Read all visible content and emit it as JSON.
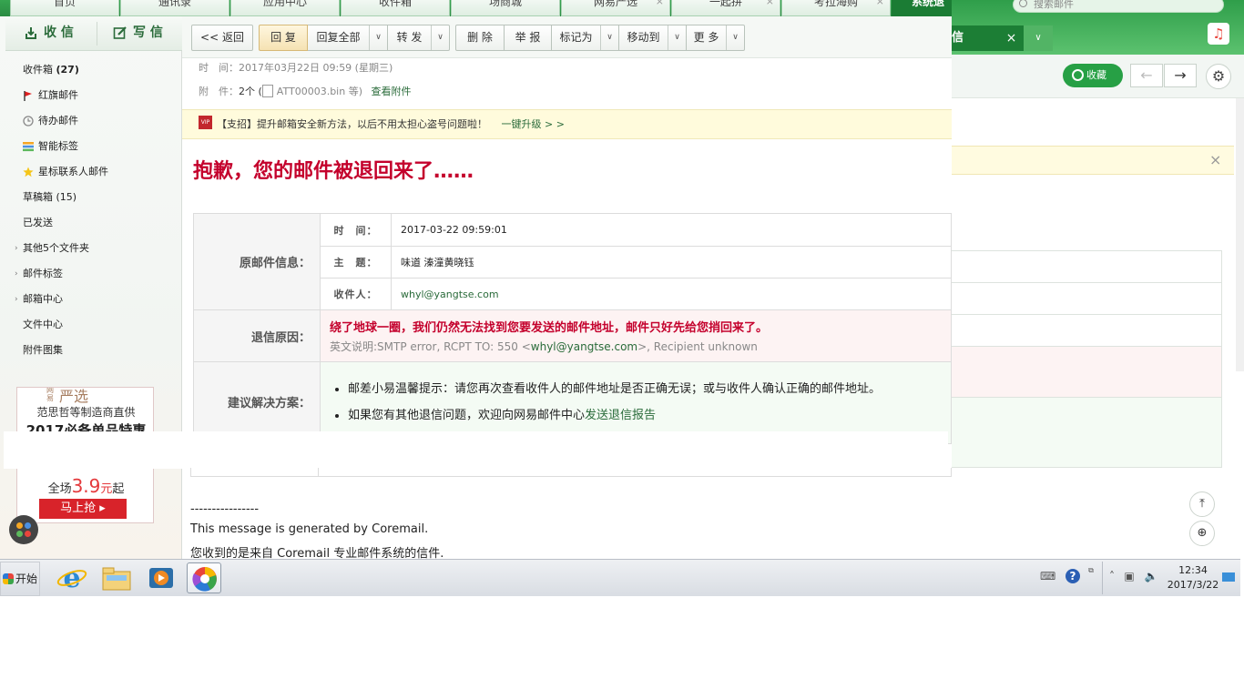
{
  "nav_tabs": [
    {
      "label": "首页",
      "closable": false
    },
    {
      "label": "通讯录",
      "closable": false
    },
    {
      "label": "应用中心",
      "closable": false
    },
    {
      "label": "收件箱",
      "closable": false
    },
    {
      "label": "场商城",
      "closable": false
    },
    {
      "label": "网易严选",
      "closable": true
    },
    {
      "label": "一起拼",
      "closable": true
    },
    {
      "label": "考拉海购",
      "closable": true
    },
    {
      "label": "系统退",
      "closable": false
    }
  ],
  "sidebar": {
    "receive_label": "收 信",
    "write_label": "写 信",
    "inbox_label": "收件箱",
    "inbox_count": "(27)",
    "items": [
      {
        "label": "红旗邮件",
        "icon": "red-flag-icon"
      },
      {
        "label": "待办邮件",
        "icon": "clock-icon"
      },
      {
        "label": "智能标签",
        "icon": "tag-stack-icon"
      },
      {
        "label": "星标联系人邮件",
        "icon": "star-icon"
      }
    ],
    "drafts_label": "草稿箱 (15)",
    "sent_label": "已发送",
    "folders": [
      {
        "label": "其他5个文件夹"
      },
      {
        "label": "邮件标签"
      },
      {
        "label": "邮箱中心"
      }
    ],
    "file_center_label": "文件中心",
    "attach_label": "附件图集",
    "ad": {
      "brand_small": "网易",
      "brand": "严选",
      "line1": "范思哲等制造商直供",
      "line2": "2017必备单品特惠",
      "line3_pre": "全场",
      "price": "3.9",
      "unit": "元",
      "line3_post": "起",
      "button": "马上抢"
    }
  },
  "toolbar": {
    "back": "<< 返回",
    "reply": "回 复",
    "reply_all": "回复全部",
    "forward": "转 发",
    "delete": "删 除",
    "report": "举 报",
    "mark": "标记为",
    "move": "移动到",
    "more": "更 多"
  },
  "header": {
    "time_label": "时　间：",
    "time_value": "2017年03月22日 09:59 (星期三)",
    "attach_label": "附　件：",
    "attach_count": "2个 (",
    "attach_file": "ATT00003.bin 等)",
    "view_attach": "查看附件"
  },
  "vip_notice": {
    "badge": "VIP",
    "text": "【支招】提升邮箱安全新方法，以后不用太担心盗号问题啦！",
    "link": "一键升级 > >"
  },
  "bounce": {
    "title": "抱歉，您的邮件被退回来了……",
    "orig_label": "原邮件信息：",
    "time_key": "时　间：",
    "time_val": "2017-03-22 09:59:01",
    "subject_key": "主　题：",
    "subject_val": "味道 溱潼黄晓钰",
    "to_key": "收件人：",
    "to_val": "whyl@yangtse.com",
    "reason_label": "退信原因：",
    "reason_cn": "绕了地球一圈，我们仍然无法找到您要发送的邮件地址，邮件只好先给您捎回来了。",
    "reason_en_pre": "英文说明:SMTP error, RCPT TO: 550 <",
    "reason_en_addr": "whyl@yangtse.com",
    "reason_en_post": ">, Recipient unknown",
    "solution_label": "建议解决方案：",
    "solution_1": "邮差小易温馨提示：请您再次查看收件人的邮件地址是否正确无误；或与收件人确认正确的邮件地址。",
    "solution_2_pre": "如果您有其他退信问题，欢迎向网易邮件中心",
    "solution_2_link": "发送退信报告"
  },
  "signature": {
    "dashes": "----------------",
    "line1": "This message is generated by Coremail.",
    "line2": "您收到的是来自 Coremail 专业邮件系统的信件."
  },
  "background_window": {
    "search_placeholder": "搜索邮件",
    "tab_label": "信",
    "collect_label": "收藏"
  },
  "taskbar": {
    "start_label": "开始",
    "time": "12:34",
    "date": "2017/3/22"
  },
  "colors": {
    "brand_green": "#2b8c43",
    "alert_red": "#c4002c",
    "link_green": "#2a6b3a"
  }
}
